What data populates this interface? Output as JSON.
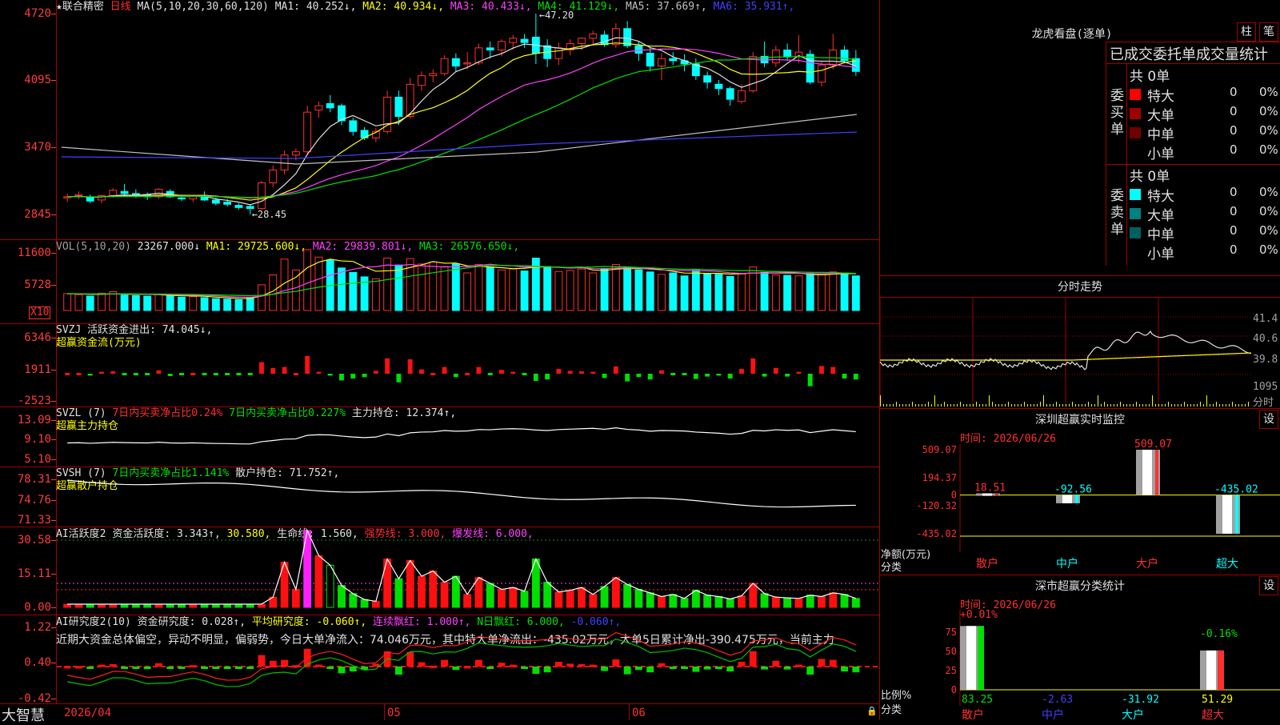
{
  "app": {
    "brand": "大智慧",
    "date_label": "2026/04",
    "month_labels": [
      "05",
      "06"
    ]
  },
  "main": {
    "title": "★联合精密",
    "period": "日线",
    "ma_label": "MA(5,10,20,30,60,120)",
    "ma": [
      {
        "label": "MA1:",
        "value": "40.252↓",
        "color": "#e0e0e0"
      },
      {
        "label": "MA2:",
        "value": "40.934↓",
        "color": "#ffff00"
      },
      {
        "label": "MA3:",
        "value": "40.433↓",
        "color": "#ff40ff"
      },
      {
        "label": "MA4:",
        "value": "41.129↓",
        "color": "#00e000"
      },
      {
        "label": "MA5:",
        "value": "37.669↑",
        "color": "#c0c0c0"
      },
      {
        "label": "MA6:",
        "value": "35.931↑",
        "color": "#4040ff"
      }
    ],
    "yticks": [
      "4720",
      "4095",
      "3470",
      "2845"
    ],
    "high_label": "47.20",
    "low_label": "28.45"
  },
  "vol": {
    "label": "VOL(5,10,20)",
    "value": "23267.000↓",
    "ma": [
      {
        "label": "MA1:",
        "value": "29725.600↓",
        "color": "#ffff00"
      },
      {
        "label": "MA2:",
        "value": "29839.801↓",
        "color": "#ff40ff"
      },
      {
        "label": "MA3:",
        "value": "26576.650↓",
        "color": "#00e000"
      }
    ],
    "yticks": [
      "11600",
      "5728"
    ],
    "unit": "X10"
  },
  "svzj": {
    "label": "SVZJ",
    "line1": "活跃资金进出: 74.045↓,",
    "line2": "超赢资金流(万元)",
    "yticks": [
      "6346",
      "1911",
      "-2523"
    ]
  },
  "svzl": {
    "label": "SVZL (7)",
    "t1": "7日内买卖净占比0.24%",
    "t2": "7日内买卖净占比0.227%",
    "t3": "主力持仓: 12.374↑,",
    "line2": "超赢主力持仓",
    "yticks": [
      "13.09",
      "9.10",
      "5.10"
    ]
  },
  "svsh": {
    "label": "SVSH (7)",
    "t1": "7日内买卖净占比1.141%",
    "t2": "散户持仓: 71.752↑,",
    "line2": "超赢散户持仓",
    "yticks": [
      "78.31",
      "74.76",
      "71.33"
    ]
  },
  "ai1": {
    "label": "AI活跃度2",
    "t1": "资金活跃度: 3.343↑,",
    "t2": "30.580,",
    "t3": "生命线: 1.560,",
    "t4": "强势线: 3.000,",
    "t5": "爆发线: 6.000,",
    "yticks": [
      "30.58",
      "15.11",
      "0.00"
    ]
  },
  "ai2": {
    "label": "AI研究度2(10)",
    "t1": "资金研究度: 0.028↑,",
    "t2": "平均研究度: -0.060↑,",
    "t3": "连续飘红: 1.000↑,",
    "t4": "N日飘红: 6.000,",
    "t5": "-0.060↑,",
    "summary": "近期大资金总体偏空，异动不明显，偏弱势，今日大单净流入：74.046万元，其中特大单净流出：-435.02万元，大单5日累计净出-390.475万元，当前主力",
    "yticks": [
      "1.22",
      "0.40",
      "-0.42"
    ]
  },
  "right": {
    "lhb_title": "龙虎看盘(逐单)",
    "btn1": "柱",
    "btn2": "笔",
    "tabs": "已成交委托单成交量统计",
    "buy_side": "委买单",
    "sell_side": "委卖单",
    "buy_total": "共 0单",
    "sell_total": "共 0单",
    "buy_rows": [
      {
        "name": "特大",
        "count": "0",
        "pct": "0%",
        "color": "#ff0000"
      },
      {
        "name": "大单",
        "count": "0",
        "pct": "0%",
        "color": "#a00000"
      },
      {
        "name": "中单",
        "count": "0",
        "pct": "0%",
        "color": "#700000"
      },
      {
        "name": "小单",
        "count": "0",
        "pct": "0%",
        "color": "#000000"
      }
    ],
    "sell_rows": [
      {
        "name": "特大",
        "count": "0",
        "pct": "0%",
        "color": "#00ffff"
      },
      {
        "name": "大单",
        "count": "0",
        "pct": "0%",
        "color": "#008080"
      },
      {
        "name": "中单",
        "count": "0",
        "pct": "0%",
        "color": "#006060"
      },
      {
        "name": "小单",
        "count": "0",
        "pct": "0%",
        "color": "#000000"
      }
    ],
    "intraday_title": "分时走势",
    "intraday_yticks": [
      "41.4",
      "40.6",
      "39.8",
      "1095",
      "分时"
    ],
    "monitor_title": "深圳超赢实时监控",
    "monitor_btn": "设",
    "monitor_time": "时间: 2026/06/26",
    "monitor_yticks": [
      "509.07",
      "194.37",
      "0",
      "-120.32",
      "-435.02"
    ],
    "monitor_ylabel": "净额(万元)",
    "monitor_xlabel": "分类",
    "monitor_bars": [
      {
        "cat": "散户",
        "value": "18.51",
        "num": 18.51,
        "color": "#ff3030"
      },
      {
        "cat": "中户",
        "value": "-92.56",
        "num": -92.56,
        "color": "#00ffff"
      },
      {
        "cat": "大户",
        "value": "509.07",
        "num": 509.07,
        "color": "#ff3030"
      },
      {
        "cat": "超大",
        "value": "-435.02",
        "num": -435.02,
        "color": "#00ffff"
      }
    ],
    "class_title": "深市超赢分类统计",
    "class_btn": "设",
    "class_time": "时间: 2026/06/26",
    "class_yticks": [
      "75",
      "50",
      "25",
      "0"
    ],
    "class_ylabel": "比例%",
    "class_xlabel": "分类",
    "class_top": [
      {
        "label": "+0.01%",
        "color": "#ff3030"
      },
      {
        "label": "-0.16%",
        "color": "#00e000"
      }
    ],
    "class_bars": [
      {
        "cat": "散户",
        "value": "83.25",
        "num": 83.25,
        "color": "#00e000"
      },
      {
        "cat": "中户",
        "value": "-2.63",
        "num": 2.63,
        "color": "#4040ff"
      },
      {
        "cat": "大户",
        "value": "-31.92",
        "num": 31.92,
        "color": "#00ffff"
      },
      {
        "cat": "超大",
        "value": "51.29",
        "num": 51.29,
        "color": "#ffff00"
      }
    ]
  },
  "chart_data": {
    "type": "candlestick",
    "ohlc": [
      [
        30.0,
        30.4,
        29.6,
        30.1
      ],
      [
        30.2,
        30.6,
        29.9,
        30.3
      ],
      [
        30.1,
        30.3,
        29.5,
        29.7
      ],
      [
        29.8,
        30.3,
        29.5,
        30.2
      ],
      [
        30.2,
        30.9,
        30.0,
        30.7
      ],
      [
        30.6,
        31.3,
        30.2,
        30.4
      ],
      [
        30.4,
        30.8,
        30.0,
        30.2
      ],
      [
        30.3,
        30.5,
        29.8,
        30.1
      ],
      [
        30.1,
        30.9,
        29.9,
        30.8
      ],
      [
        30.6,
        30.8,
        30.0,
        30.1
      ],
      [
        30.0,
        30.3,
        29.7,
        29.9
      ],
      [
        29.9,
        30.3,
        29.6,
        30.2
      ],
      [
        30.1,
        30.6,
        29.7,
        29.8
      ],
      [
        29.8,
        30.0,
        29.3,
        29.5
      ],
      [
        29.6,
        29.9,
        29.2,
        29.4
      ],
      [
        29.3,
        29.5,
        28.9,
        29.1
      ],
      [
        29.2,
        29.4,
        28.45,
        29.0
      ],
      [
        29.0,
        31.6,
        28.9,
        31.4
      ],
      [
        31.4,
        33.0,
        31.0,
        32.6
      ],
      [
        32.6,
        34.4,
        32.2,
        34.0
      ],
      [
        34.0,
        34.6,
        33.5,
        34.3
      ],
      [
        34.3,
        38.6,
        34.0,
        38.0
      ],
      [
        38.2,
        39.0,
        37.5,
        38.6
      ],
      [
        38.8,
        39.6,
        38.0,
        38.4
      ],
      [
        38.6,
        38.8,
        36.8,
        37.2
      ],
      [
        37.2,
        37.5,
        35.8,
        36.2
      ],
      [
        36.3,
        36.6,
        35.4,
        35.6
      ],
      [
        35.6,
        36.5,
        35.2,
        36.2
      ],
      [
        36.2,
        40.0,
        36.0,
        39.4
      ],
      [
        39.4,
        40.0,
        36.8,
        37.6
      ],
      [
        37.6,
        41.2,
        37.4,
        40.6
      ],
      [
        40.5,
        41.8,
        40.0,
        41.4
      ],
      [
        41.4,
        42.0,
        40.8,
        41.6
      ],
      [
        41.6,
        43.3,
        41.4,
        43.0
      ],
      [
        43.0,
        43.5,
        41.8,
        42.3
      ],
      [
        42.5,
        43.6,
        42.0,
        42.6
      ],
      [
        42.6,
        44.4,
        42.4,
        44.0
      ],
      [
        44.0,
        44.6,
        43.0,
        43.8
      ],
      [
        43.8,
        44.8,
        43.2,
        44.6
      ],
      [
        44.5,
        45.2,
        43.8,
        44.9
      ],
      [
        44.8,
        45.3,
        44.0,
        44.5
      ],
      [
        45.0,
        47.2,
        42.5,
        43.5
      ],
      [
        44.2,
        44.8,
        42.2,
        43.0
      ],
      [
        43.0,
        44.5,
        42.4,
        44.0
      ],
      [
        43.8,
        44.8,
        43.3,
        44.4
      ],
      [
        44.4,
        45.0,
        43.8,
        44.9
      ],
      [
        44.9,
        45.6,
        44.2,
        45.3
      ],
      [
        45.2,
        45.6,
        44.1,
        44.3
      ],
      [
        44.3,
        46.3,
        44.0,
        45.8
      ],
      [
        45.8,
        46.5,
        44.0,
        44.2
      ],
      [
        44.2,
        44.6,
        42.8,
        43.5
      ],
      [
        43.5,
        44.0,
        41.8,
        42.3
      ],
      [
        42.3,
        43.5,
        41.0,
        43.0
      ],
      [
        43.0,
        43.6,
        42.4,
        42.8
      ],
      [
        42.8,
        43.4,
        41.8,
        42.5
      ],
      [
        42.5,
        43.0,
        41.0,
        41.4
      ],
      [
        41.4,
        41.8,
        40.2,
        40.8
      ],
      [
        40.6,
        41.0,
        39.6,
        40.2
      ],
      [
        40.2,
        40.4,
        38.6,
        39.2
      ],
      [
        39.0,
        40.6,
        38.8,
        40.0
      ],
      [
        40.0,
        43.6,
        39.8,
        43.2
      ],
      [
        43.2,
        44.6,
        42.2,
        42.6
      ],
      [
        42.6,
        44.2,
        42.2,
        43.8
      ],
      [
        43.8,
        44.4,
        42.8,
        43.2
      ],
      [
        43.2,
        45.2,
        42.6,
        43.6
      ],
      [
        43.4,
        43.8,
        40.6,
        40.8
      ],
      [
        40.8,
        42.8,
        40.4,
        42.4
      ],
      [
        42.4,
        45.3,
        42.0,
        43.8
      ],
      [
        43.8,
        44.2,
        42.6,
        42.8
      ],
      [
        43.0,
        43.8,
        41.4,
        41.8
      ]
    ],
    "vol": [
      3400,
      3200,
      2900,
      3500,
      3800,
      3100,
      3000,
      2900,
      3300,
      3000,
      2700,
      2800,
      2600,
      2400,
      2300,
      2200,
      2600,
      5200,
      7200,
      10400,
      8200,
      12300,
      10800,
      10200,
      8600,
      7700,
      6800,
      6400,
      10600,
      9200,
      10500,
      9400,
      9800,
      8900,
      9400,
      7600,
      9300,
      8800,
      8200,
      8400,
      8000,
      10600,
      8900,
      7900,
      8100,
      8400,
      7600,
      8500,
      9300,
      8700,
      8200,
      7800,
      7300,
      7600,
      7000,
      8100,
      7500,
      7300,
      6900,
      7400,
      8800,
      7700,
      7200,
      7100,
      7000,
      7500,
      7300,
      7800,
      7600,
      7000
    ],
    "series_names": [
      "MA1",
      "MA2",
      "MA3",
      "MA4",
      "MA5",
      "MA6"
    ]
  }
}
